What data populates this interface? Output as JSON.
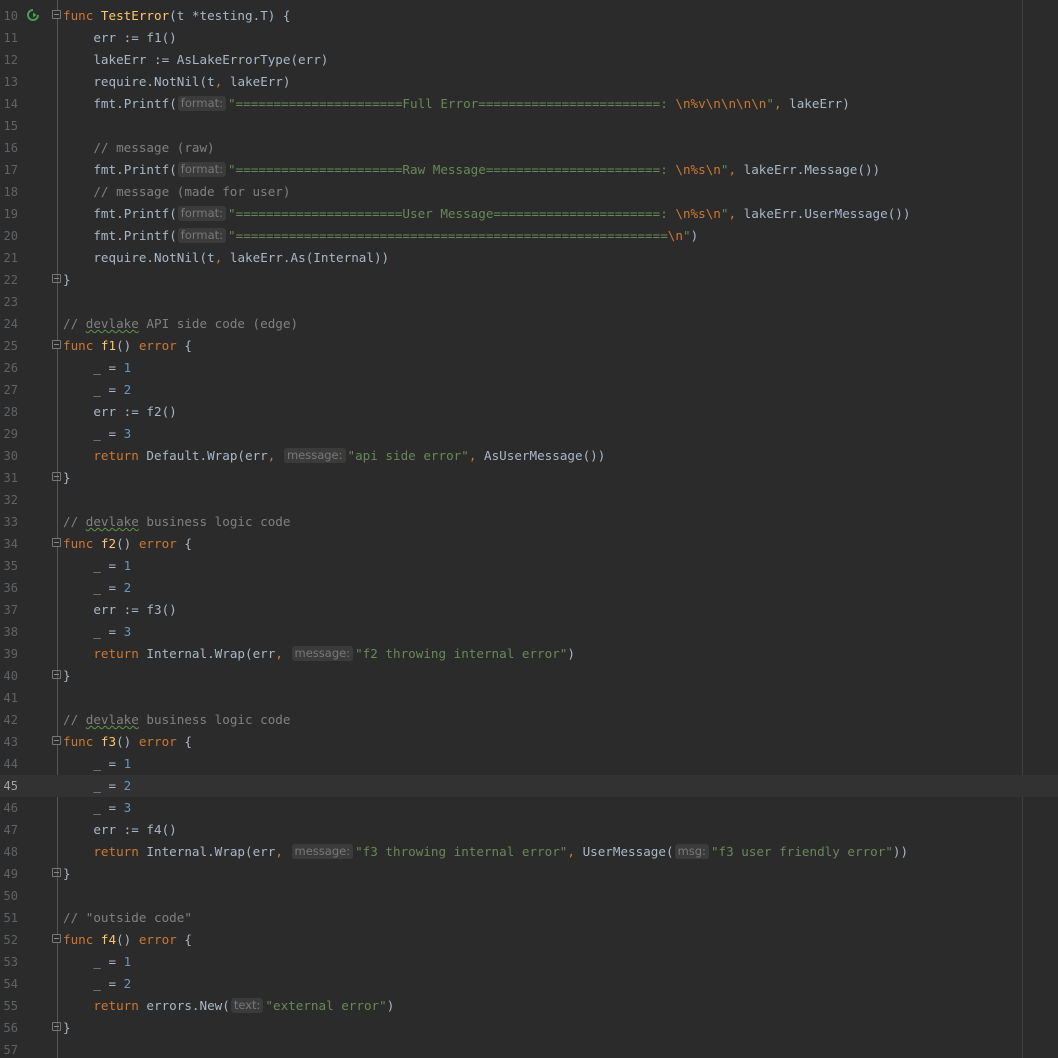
{
  "lines": [
    {
      "n": "10",
      "fold": "start",
      "run_icon": true,
      "tokens": [
        [
          "kw",
          "func "
        ],
        [
          "fn",
          "TestError"
        ],
        [
          "p",
          "(t *"
        ],
        [
          "p",
          "testing"
        ],
        [
          "p",
          "."
        ],
        [
          "p",
          "T) {"
        ]
      ]
    },
    {
      "n": "11",
      "tokens": [
        [
          "p",
          "    err := "
        ],
        [
          "p",
          "f1"
        ],
        [
          "p",
          "()"
        ]
      ]
    },
    {
      "n": "12",
      "tokens": [
        [
          "p",
          "    lakeErr := "
        ],
        [
          "p",
          "AsLakeErrorType"
        ],
        [
          "p",
          "(err)"
        ]
      ]
    },
    {
      "n": "13",
      "tokens": [
        [
          "p",
          "    "
        ],
        [
          "fn2",
          "require"
        ],
        [
          "p",
          "."
        ],
        [
          "fn2",
          "NotNil"
        ],
        [
          "p",
          "(t"
        ],
        [
          "kw",
          ", "
        ],
        [
          "p",
          "lakeErr)"
        ]
      ]
    },
    {
      "n": "14",
      "tokens": [
        [
          "p",
          "    "
        ],
        [
          "fn2",
          "fmt"
        ],
        [
          "p",
          "."
        ],
        [
          "fn2",
          "Printf"
        ],
        [
          "p",
          "("
        ],
        [
          "hint",
          "format:"
        ],
        [
          "str",
          "\"======================Full Error========================: "
        ],
        [
          "esc",
          "\\n%v\\n\\n\\n\\n"
        ],
        [
          "str",
          "\""
        ],
        [
          "kw",
          ", "
        ],
        [
          "p",
          "lakeErr)"
        ]
      ]
    },
    {
      "n": "15",
      "tokens": []
    },
    {
      "n": "16",
      "tokens": [
        [
          "cmt",
          "    // message (raw)"
        ]
      ]
    },
    {
      "n": "17",
      "tokens": [
        [
          "p",
          "    "
        ],
        [
          "fn2",
          "fmt"
        ],
        [
          "p",
          "."
        ],
        [
          "fn2",
          "Printf"
        ],
        [
          "p",
          "("
        ],
        [
          "hint",
          "format:"
        ],
        [
          "str",
          "\"======================Raw Message=======================: "
        ],
        [
          "esc",
          "\\n%s\\n"
        ],
        [
          "str",
          "\""
        ],
        [
          "kw",
          ", "
        ],
        [
          "p",
          "lakeErr."
        ],
        [
          "fn2",
          "Message"
        ],
        [
          "p",
          "())"
        ]
      ]
    },
    {
      "n": "18",
      "tokens": [
        [
          "cmt",
          "    // message (made for user)"
        ]
      ]
    },
    {
      "n": "19",
      "tokens": [
        [
          "p",
          "    "
        ],
        [
          "fn2",
          "fmt"
        ],
        [
          "p",
          "."
        ],
        [
          "fn2",
          "Printf"
        ],
        [
          "p",
          "("
        ],
        [
          "hint",
          "format:"
        ],
        [
          "str",
          "\"======================User Message======================: "
        ],
        [
          "esc",
          "\\n%s\\n"
        ],
        [
          "str",
          "\""
        ],
        [
          "kw",
          ", "
        ],
        [
          "p",
          "lakeErr."
        ],
        [
          "fn2",
          "UserMessage"
        ],
        [
          "p",
          "())"
        ]
      ]
    },
    {
      "n": "20",
      "tokens": [
        [
          "p",
          "    "
        ],
        [
          "fn2",
          "fmt"
        ],
        [
          "p",
          "."
        ],
        [
          "fn2",
          "Printf"
        ],
        [
          "p",
          "("
        ],
        [
          "hint",
          "format:"
        ],
        [
          "str",
          "\"========================================================="
        ],
        [
          "esc",
          "\\n"
        ],
        [
          "str",
          "\""
        ],
        [
          "p",
          ")"
        ]
      ]
    },
    {
      "n": "21",
      "tokens": [
        [
          "p",
          "    "
        ],
        [
          "fn2",
          "require"
        ],
        [
          "p",
          "."
        ],
        [
          "fn2",
          "NotNil"
        ],
        [
          "p",
          "(t"
        ],
        [
          "kw",
          ", "
        ],
        [
          "p",
          "lakeErr."
        ],
        [
          "fn2",
          "As"
        ],
        [
          "p",
          "(Internal))"
        ]
      ]
    },
    {
      "n": "22",
      "fold": "end",
      "tokens": [
        [
          "p",
          "}"
        ]
      ]
    },
    {
      "n": "23",
      "tokens": []
    },
    {
      "n": "24",
      "tokens": [
        [
          "cmt",
          "// "
        ],
        [
          "cmtt",
          "devlake"
        ],
        [
          "cmt",
          " API side code (edge)"
        ]
      ]
    },
    {
      "n": "25",
      "fold": "start",
      "tokens": [
        [
          "kw",
          "func "
        ],
        [
          "fn",
          "f1"
        ],
        [
          "p",
          "() "
        ],
        [
          "kw",
          "error"
        ],
        [
          "p",
          " {"
        ]
      ]
    },
    {
      "n": "26",
      "tokens": [
        [
          "p",
          "    _ = "
        ],
        [
          "num",
          "1"
        ]
      ]
    },
    {
      "n": "27",
      "tokens": [
        [
          "p",
          "    _ = "
        ],
        [
          "num",
          "2"
        ]
      ]
    },
    {
      "n": "28",
      "tokens": [
        [
          "p",
          "    err := "
        ],
        [
          "p",
          "f2"
        ],
        [
          "p",
          "()"
        ]
      ]
    },
    {
      "n": "29",
      "tokens": [
        [
          "p",
          "    _ = "
        ],
        [
          "num",
          "3"
        ]
      ]
    },
    {
      "n": "30",
      "tokens": [
        [
          "kw",
          "    return "
        ],
        [
          "p",
          "Default."
        ],
        [
          "fn2",
          "Wrap"
        ],
        [
          "p",
          "(err"
        ],
        [
          "kw",
          ", "
        ],
        [
          "hint",
          "message:"
        ],
        [
          "str",
          "\"api side error\""
        ],
        [
          "kw",
          ", "
        ],
        [
          "fn2",
          "AsUserMessage"
        ],
        [
          "p",
          "())"
        ]
      ]
    },
    {
      "n": "31",
      "fold": "end",
      "tokens": [
        [
          "p",
          "}"
        ]
      ]
    },
    {
      "n": "32",
      "tokens": []
    },
    {
      "n": "33",
      "tokens": [
        [
          "cmt",
          "// "
        ],
        [
          "cmtt",
          "devlake"
        ],
        [
          "cmt",
          " business logic code"
        ]
      ]
    },
    {
      "n": "34",
      "fold": "start",
      "tokens": [
        [
          "kw",
          "func "
        ],
        [
          "fn",
          "f2"
        ],
        [
          "p",
          "() "
        ],
        [
          "kw",
          "error"
        ],
        [
          "p",
          " {"
        ]
      ]
    },
    {
      "n": "35",
      "tokens": [
        [
          "p",
          "    _ = "
        ],
        [
          "num",
          "1"
        ]
      ]
    },
    {
      "n": "36",
      "tokens": [
        [
          "p",
          "    _ = "
        ],
        [
          "num",
          "2"
        ]
      ]
    },
    {
      "n": "37",
      "tokens": [
        [
          "p",
          "    err := "
        ],
        [
          "p",
          "f3"
        ],
        [
          "p",
          "()"
        ]
      ]
    },
    {
      "n": "38",
      "tokens": [
        [
          "p",
          "    _ = "
        ],
        [
          "num",
          "3"
        ]
      ]
    },
    {
      "n": "39",
      "tokens": [
        [
          "kw",
          "    return "
        ],
        [
          "p",
          "Internal."
        ],
        [
          "fn2",
          "Wrap"
        ],
        [
          "p",
          "(err"
        ],
        [
          "kw",
          ", "
        ],
        [
          "hint",
          "message:"
        ],
        [
          "str",
          "\"f2 throwing internal error\""
        ],
        [
          "p",
          ")"
        ]
      ]
    },
    {
      "n": "40",
      "fold": "end",
      "tokens": [
        [
          "p",
          "}"
        ]
      ]
    },
    {
      "n": "41",
      "tokens": []
    },
    {
      "n": "42",
      "tokens": [
        [
          "cmt",
          "// "
        ],
        [
          "cmtt",
          "devlake"
        ],
        [
          "cmt",
          " business logic code"
        ]
      ]
    },
    {
      "n": "43",
      "fold": "start",
      "tokens": [
        [
          "kw",
          "func "
        ],
        [
          "fn",
          "f3"
        ],
        [
          "p",
          "() "
        ],
        [
          "kw",
          "error"
        ],
        [
          "p",
          " {"
        ]
      ]
    },
    {
      "n": "44",
      "tokens": [
        [
          "p",
          "    _ = "
        ],
        [
          "num",
          "1"
        ]
      ]
    },
    {
      "n": "45",
      "current": true,
      "tokens": [
        [
          "p",
          "    _ = "
        ],
        [
          "num",
          "2"
        ]
      ]
    },
    {
      "n": "46",
      "tokens": [
        [
          "p",
          "    _ = "
        ],
        [
          "num",
          "3"
        ]
      ]
    },
    {
      "n": "47",
      "tokens": [
        [
          "p",
          "    err := "
        ],
        [
          "p",
          "f4"
        ],
        [
          "p",
          "()"
        ]
      ]
    },
    {
      "n": "48",
      "tokens": [
        [
          "kw",
          "    return "
        ],
        [
          "p",
          "Internal."
        ],
        [
          "fn2",
          "Wrap"
        ],
        [
          "p",
          "(err"
        ],
        [
          "kw",
          ", "
        ],
        [
          "hint",
          "message:"
        ],
        [
          "str",
          "\"f3 throwing internal error\""
        ],
        [
          "kw",
          ", "
        ],
        [
          "fn2",
          "UserMessage"
        ],
        [
          "p",
          "("
        ],
        [
          "hint",
          "msg:"
        ],
        [
          "str",
          "\"f3 user friendly error\""
        ],
        [
          "p",
          "))"
        ]
      ]
    },
    {
      "n": "49",
      "fold": "end",
      "tokens": [
        [
          "p",
          "}"
        ]
      ]
    },
    {
      "n": "50",
      "tokens": []
    },
    {
      "n": "51",
      "tokens": [
        [
          "cmt",
          "// \"outside code\""
        ]
      ]
    },
    {
      "n": "52",
      "fold": "start",
      "tokens": [
        [
          "kw",
          "func "
        ],
        [
          "fn",
          "f4"
        ],
        [
          "p",
          "() "
        ],
        [
          "kw",
          "error"
        ],
        [
          "p",
          " {"
        ]
      ]
    },
    {
      "n": "53",
      "tokens": [
        [
          "p",
          "    _ = "
        ],
        [
          "num",
          "1"
        ]
      ]
    },
    {
      "n": "54",
      "tokens": [
        [
          "p",
          "    _ = "
        ],
        [
          "num",
          "2"
        ]
      ]
    },
    {
      "n": "55",
      "tokens": [
        [
          "kw",
          "    return "
        ],
        [
          "p",
          "errors."
        ],
        [
          "fn2",
          "New"
        ],
        [
          "p",
          "("
        ],
        [
          "hint",
          "text:"
        ],
        [
          "str",
          "\"external error\""
        ],
        [
          "p",
          ")"
        ]
      ]
    },
    {
      "n": "56",
      "fold": "end",
      "tokens": [
        [
          "p",
          "}"
        ]
      ]
    },
    {
      "n": "57",
      "tokens": []
    }
  ],
  "colors": {
    "background": "#2b2b2b",
    "keyword": "#cc7832",
    "function": "#ffc66d",
    "number": "#6897bb",
    "string": "#6a8759",
    "comment": "#808080",
    "text": "#a9b7c6",
    "run_icon": "#499c54"
  },
  "icons": {
    "run": "run-test-icon",
    "fold": "fold-marker-icon"
  }
}
